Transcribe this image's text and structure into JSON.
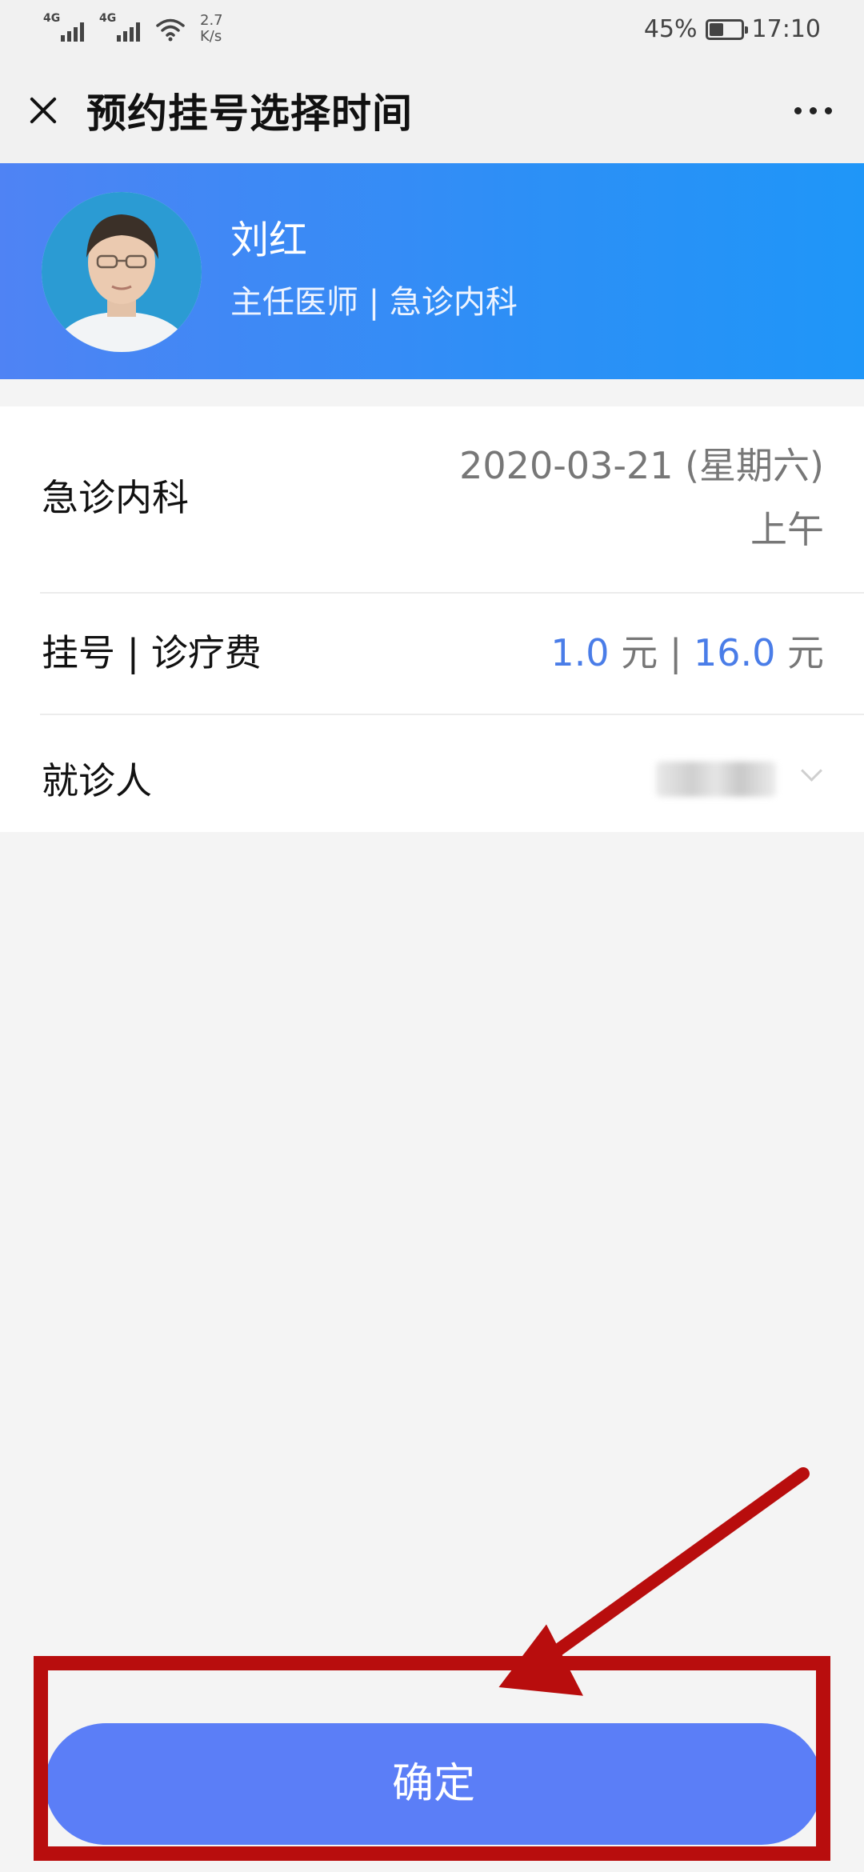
{
  "status_bar": {
    "network_1": "4G",
    "network_2": "4G",
    "speed_value": "2.7",
    "speed_unit": "K/s",
    "battery_percent": "45%",
    "battery_level": 0.45,
    "time": "17:10"
  },
  "header": {
    "title": "预约挂号选择时间"
  },
  "doctor": {
    "name": "刘红",
    "title_dept": "主任医师 | 急诊内科"
  },
  "appointment": {
    "department": "急诊内科",
    "date": "2020-03-21 (星期六)",
    "period": "上午",
    "fee_label": "挂号 | 诊疗费",
    "registration_fee": "1.0",
    "fee_unit": "元",
    "fee_separator": "|",
    "treatment_fee": "16.0",
    "patient_label": "就诊人"
  },
  "actions": {
    "confirm_label": "确定"
  },
  "colors": {
    "banner": "#2d8ff6",
    "confirm": "#5b7ef7",
    "annotation": "#b80d0d",
    "fee_amount": "#4a7de8"
  }
}
